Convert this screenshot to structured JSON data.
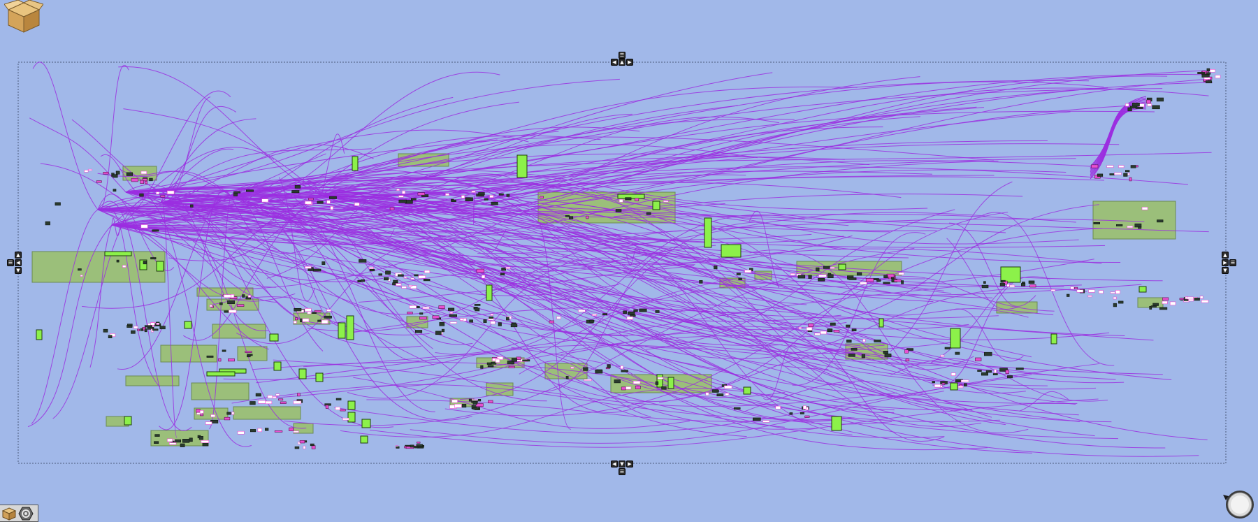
{
  "app": {
    "view": "node-graph-canvas"
  },
  "colors": {
    "background": "#a1b8e9",
    "wire": "#9b2ee0",
    "group_fill": "#9bbf7a",
    "group_stroke": "#6a8a52",
    "panel_green": "#8cf14a",
    "node_dark": "#2a3a2e",
    "node_pink": "#e84fd0",
    "node_white": "#ffffff"
  },
  "icons": {
    "logo": "open-box-icon",
    "align_top": "align-top-icon",
    "align_bottom": "align-bottom-icon",
    "align_left": "align-left-icon",
    "align_right": "align-right-icon",
    "arrow_left": "arrow-left-icon",
    "arrow_right": "arrow-right-icon",
    "arrow_up": "arrow-up-icon",
    "arrow_down": "arrow-down-icon",
    "tool_box": "box-tool-icon",
    "tool_settings": "gear-hex-icon",
    "navigator": "navigator-dial-icon"
  }
}
